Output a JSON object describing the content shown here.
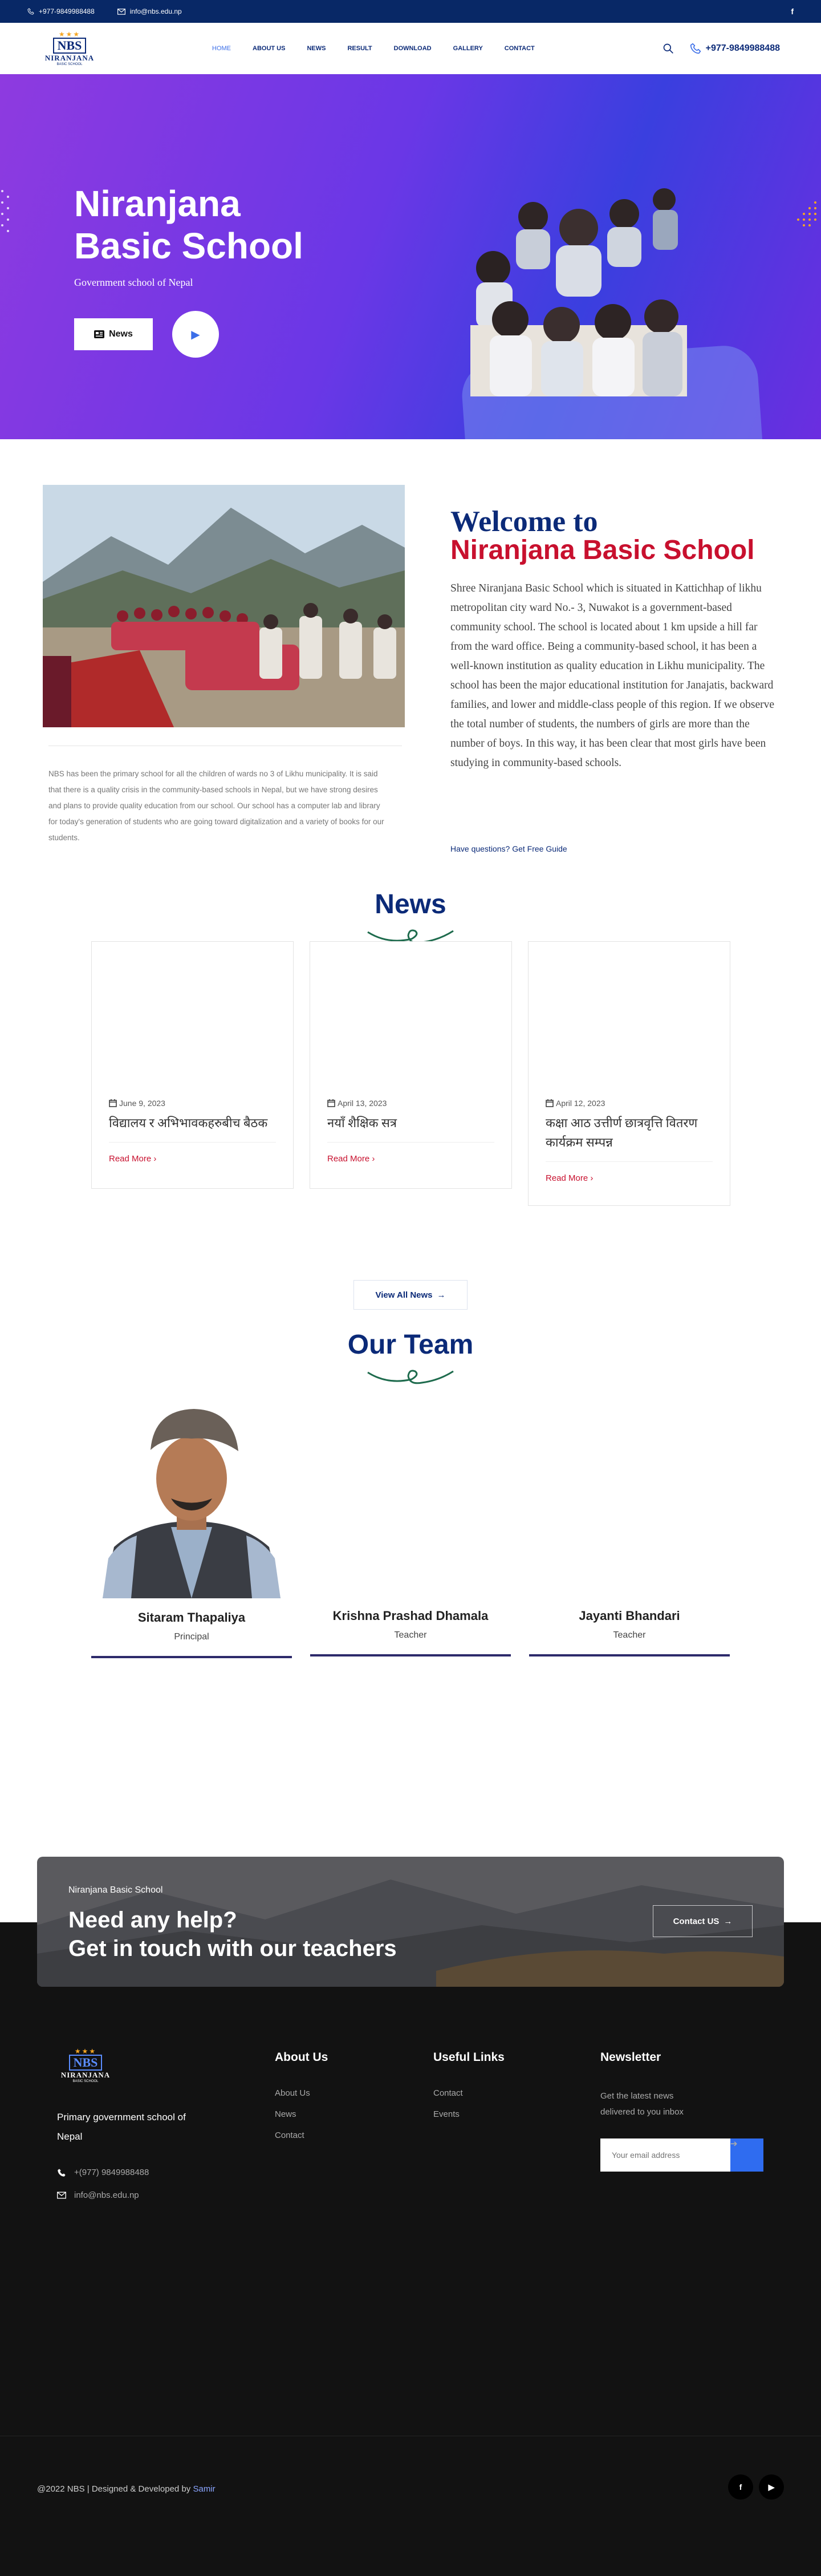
{
  "topbar": {
    "phone": "+977-9849988488",
    "email": "info@nbs.edu.np",
    "facebook": "f"
  },
  "logo": {
    "abbr": "NBS",
    "name": "NIRANJANA",
    "sub": "BASIC SCHOOL"
  },
  "nav": {
    "items": [
      "HOME",
      "ABOUT US",
      "NEWS",
      "RESULT",
      "DOWNLOAD",
      "GALLERY",
      "CONTACT"
    ],
    "active": "HOME"
  },
  "header": {
    "phone": "+977-9849988488"
  },
  "hero": {
    "title_line1": "Niranjana",
    "title_line2": "Basic School",
    "subtitle": "Government school of Nepal",
    "button": "News"
  },
  "welcome": {
    "heading_line1": "Welcome to",
    "heading_line2": "Niranjana Basic School",
    "body": "Shree Niranjana Basic School which is situated in Kattichhap of likhu metropolitan city ward No.- 3, Nuwakot is a government-based community school. The school is located about 1 km upside a hill far from the ward office. Being a community-based school, it has been a well-known institution as quality education in Likhu municipality. The school has been the major educational institution for Janajatis, backward families, and lower and middle-class people of this region. If we observe the total number of students, the numbers of girls are more than the number of boys.  In this way, it has been clear that most girls have been studying in community-based schools.",
    "description": "NBS has been the primary school for all the children of wards no 3 of Likhu municipality. It is said that there is a quality crisis in the community-based schools in Nepal, but we have strong desires and plans to provide quality education from our school. Our school has a computer lab and library for today's generation of students who are going toward digitalization and a variety of books for our students.",
    "question": "Have questions?",
    "guide_link": "Get Free Guide"
  },
  "news": {
    "title": "News",
    "read_more": "Read More",
    "view_all": "View All News",
    "items": [
      {
        "date": "June 9, 2023",
        "title": "विद्यालय र अभिभावकहरुबीच बैठक"
      },
      {
        "date": "April 13, 2023",
        "title": "नयाँ शैक्षिक सत्र"
      },
      {
        "date": "April 12, 2023",
        "title": "कक्षा आठ उत्तीर्ण छात्रवृत्ति वितरण कार्यक्रम सम्पन्न"
      }
    ]
  },
  "team": {
    "title": "Our Team",
    "members": [
      {
        "name": "Sitaram Thapaliya",
        "role": "Principal"
      },
      {
        "name": "Krishna Prashad Dhamala",
        "role": "Teacher"
      },
      {
        "name": "Jayanti Bhandari",
        "role": "Teacher"
      }
    ]
  },
  "cta": {
    "small": "Niranjana Basic School",
    "line1": "Need any help?",
    "line2": "Get in touch with our teachers",
    "button": "Contact US"
  },
  "footer": {
    "tagline": "Primary government school of Nepal",
    "phone": "+(977) 9849988488",
    "email": "info@nbs.edu.np",
    "about": {
      "title": "About Us",
      "links": [
        "About Us",
        "News",
        "Contact"
      ]
    },
    "useful": {
      "title": "Useful Links",
      "links": [
        "Contact",
        "Events"
      ]
    },
    "newsletter": {
      "title": "Newsletter",
      "desc": "Get the latest news delivered to you inbox",
      "placeholder": "Your email address"
    },
    "copyright_prefix": "@2022 NBS | Designed & Developed by",
    "copyright_author": "Samir"
  },
  "colors": {
    "navy": "#0b2a78",
    "red": "#c8102e",
    "blue": "#2f6cf0",
    "topbar": "#082866",
    "footer": "#121212"
  }
}
